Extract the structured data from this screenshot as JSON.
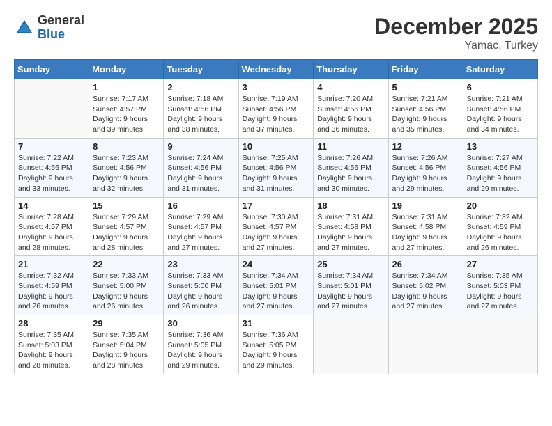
{
  "logo": {
    "general": "General",
    "blue": "Blue"
  },
  "title": "December 2025",
  "location": "Yamac, Turkey",
  "weekdays": [
    "Sunday",
    "Monday",
    "Tuesday",
    "Wednesday",
    "Thursday",
    "Friday",
    "Saturday"
  ],
  "weeks": [
    [
      {
        "day": "",
        "info": ""
      },
      {
        "day": "1",
        "info": "Sunrise: 7:17 AM\nSunset: 4:57 PM\nDaylight: 9 hours\nand 39 minutes."
      },
      {
        "day": "2",
        "info": "Sunrise: 7:18 AM\nSunset: 4:56 PM\nDaylight: 9 hours\nand 38 minutes."
      },
      {
        "day": "3",
        "info": "Sunrise: 7:19 AM\nSunset: 4:56 PM\nDaylight: 9 hours\nand 37 minutes."
      },
      {
        "day": "4",
        "info": "Sunrise: 7:20 AM\nSunset: 4:56 PM\nDaylight: 9 hours\nand 36 minutes."
      },
      {
        "day": "5",
        "info": "Sunrise: 7:21 AM\nSunset: 4:56 PM\nDaylight: 9 hours\nand 35 minutes."
      },
      {
        "day": "6",
        "info": "Sunrise: 7:21 AM\nSunset: 4:56 PM\nDaylight: 9 hours\nand 34 minutes."
      }
    ],
    [
      {
        "day": "7",
        "info": "Sunrise: 7:22 AM\nSunset: 4:56 PM\nDaylight: 9 hours\nand 33 minutes."
      },
      {
        "day": "8",
        "info": "Sunrise: 7:23 AM\nSunset: 4:56 PM\nDaylight: 9 hours\nand 32 minutes."
      },
      {
        "day": "9",
        "info": "Sunrise: 7:24 AM\nSunset: 4:56 PM\nDaylight: 9 hours\nand 31 minutes."
      },
      {
        "day": "10",
        "info": "Sunrise: 7:25 AM\nSunset: 4:56 PM\nDaylight: 9 hours\nand 31 minutes."
      },
      {
        "day": "11",
        "info": "Sunrise: 7:26 AM\nSunset: 4:56 PM\nDaylight: 9 hours\nand 30 minutes."
      },
      {
        "day": "12",
        "info": "Sunrise: 7:26 AM\nSunset: 4:56 PM\nDaylight: 9 hours\nand 29 minutes."
      },
      {
        "day": "13",
        "info": "Sunrise: 7:27 AM\nSunset: 4:56 PM\nDaylight: 9 hours\nand 29 minutes."
      }
    ],
    [
      {
        "day": "14",
        "info": "Sunrise: 7:28 AM\nSunset: 4:57 PM\nDaylight: 9 hours\nand 28 minutes."
      },
      {
        "day": "15",
        "info": "Sunrise: 7:29 AM\nSunset: 4:57 PM\nDaylight: 9 hours\nand 28 minutes."
      },
      {
        "day": "16",
        "info": "Sunrise: 7:29 AM\nSunset: 4:57 PM\nDaylight: 9 hours\nand 27 minutes."
      },
      {
        "day": "17",
        "info": "Sunrise: 7:30 AM\nSunset: 4:57 PM\nDaylight: 9 hours\nand 27 minutes."
      },
      {
        "day": "18",
        "info": "Sunrise: 7:31 AM\nSunset: 4:58 PM\nDaylight: 9 hours\nand 27 minutes."
      },
      {
        "day": "19",
        "info": "Sunrise: 7:31 AM\nSunset: 4:58 PM\nDaylight: 9 hours\nand 27 minutes."
      },
      {
        "day": "20",
        "info": "Sunrise: 7:32 AM\nSunset: 4:59 PM\nDaylight: 9 hours\nand 26 minutes."
      }
    ],
    [
      {
        "day": "21",
        "info": "Sunrise: 7:32 AM\nSunset: 4:59 PM\nDaylight: 9 hours\nand 26 minutes."
      },
      {
        "day": "22",
        "info": "Sunrise: 7:33 AM\nSunset: 5:00 PM\nDaylight: 9 hours\nand 26 minutes."
      },
      {
        "day": "23",
        "info": "Sunrise: 7:33 AM\nSunset: 5:00 PM\nDaylight: 9 hours\nand 26 minutes."
      },
      {
        "day": "24",
        "info": "Sunrise: 7:34 AM\nSunset: 5:01 PM\nDaylight: 9 hours\nand 27 minutes."
      },
      {
        "day": "25",
        "info": "Sunrise: 7:34 AM\nSunset: 5:01 PM\nDaylight: 9 hours\nand 27 minutes."
      },
      {
        "day": "26",
        "info": "Sunrise: 7:34 AM\nSunset: 5:02 PM\nDaylight: 9 hours\nand 27 minutes."
      },
      {
        "day": "27",
        "info": "Sunrise: 7:35 AM\nSunset: 5:03 PM\nDaylight: 9 hours\nand 27 minutes."
      }
    ],
    [
      {
        "day": "28",
        "info": "Sunrise: 7:35 AM\nSunset: 5:03 PM\nDaylight: 9 hours\nand 28 minutes."
      },
      {
        "day": "29",
        "info": "Sunrise: 7:35 AM\nSunset: 5:04 PM\nDaylight: 9 hours\nand 28 minutes."
      },
      {
        "day": "30",
        "info": "Sunrise: 7:36 AM\nSunset: 5:05 PM\nDaylight: 9 hours\nand 29 minutes."
      },
      {
        "day": "31",
        "info": "Sunrise: 7:36 AM\nSunset: 5:05 PM\nDaylight: 9 hours\nand 29 minutes."
      },
      {
        "day": "",
        "info": ""
      },
      {
        "day": "",
        "info": ""
      },
      {
        "day": "",
        "info": ""
      }
    ]
  ]
}
